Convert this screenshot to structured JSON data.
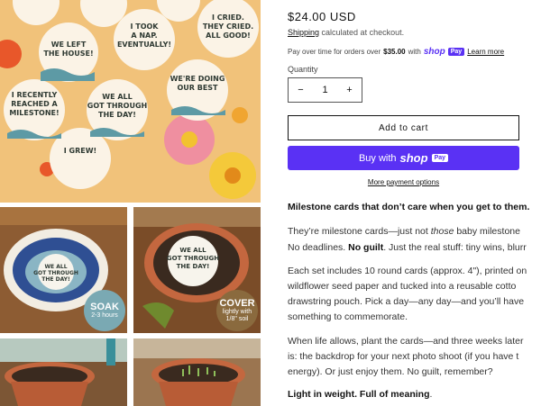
{
  "gallery": {
    "main_alt": "Milestone cards on yellow background",
    "cards": [
      "WE LEFT THE HOUSE!",
      "I TOOK A NAP. EVENTUALLY!",
      "I CRIED. THEY CRIED. ALL GOOD!",
      "I RECENTLY REACHED A MILESTONE!",
      "WE ALL GOT THROUGH THE DAY!",
      "WE'RE DOING OUR BEST",
      "I GREW!"
    ],
    "thumb1_card": "WE ALL GOT THROUGH THE DAY!",
    "thumb2_card": "WE ALL GOT THROUGH THE DAY!",
    "soak_title": "SOAK",
    "soak_sub": "2-3 hours",
    "cover_title": "COVER",
    "cover_sub": "lightly with 1/8\" soil"
  },
  "product": {
    "price": "$24.00 USD",
    "shipping_link": "Shipping",
    "shipping_rest": " calculated at checkout.",
    "payover_pre": "Pay over time for orders over ",
    "payover_amount": "$35.00",
    "payover_with": " with ",
    "shop_logo": "shop",
    "pay_chip": "Pay",
    "learn_more": "Learn more",
    "quantity_label": "Quantity",
    "quantity_value": "1",
    "minus": "−",
    "plus": "+",
    "add_to_cart": "Add to cart",
    "buy_with": "Buy with",
    "buy_logo": "shop",
    "buy_pill": "Pay",
    "more_payment": "More payment options"
  },
  "description": {
    "heading": "Milestone cards that don’t care when you get to them.",
    "p1_l1_a": "They’re milestone cards—just not ",
    "p1_l1_em": "those",
    "p1_l1_b": " baby milestone",
    "p1_l2_a": "No deadlines. ",
    "p1_l2_b": "No guilt",
    "p1_l2_c": ". Just the real stuff: tiny wins, blurr",
    "p2_l1": "Each set includes 10 round cards (approx. 4\"), printed on",
    "p2_l2": "wildflower seed paper and tucked into a reusable cotto",
    "p2_l3": "drawstring pouch. Pick a day—any day—and you’ll have",
    "p2_l4": "something to commemorate.",
    "p3_l1": "When life allows, plant the cards—and three weeks later",
    "p3_l2": "is: the backdrop for your next photo shoot (if you have t",
    "p3_l3": "energy). Or just enjoy them. No guilt, remember?",
    "footer_bold": "Light in weight. Full of meaning",
    "footer_dot": "."
  }
}
